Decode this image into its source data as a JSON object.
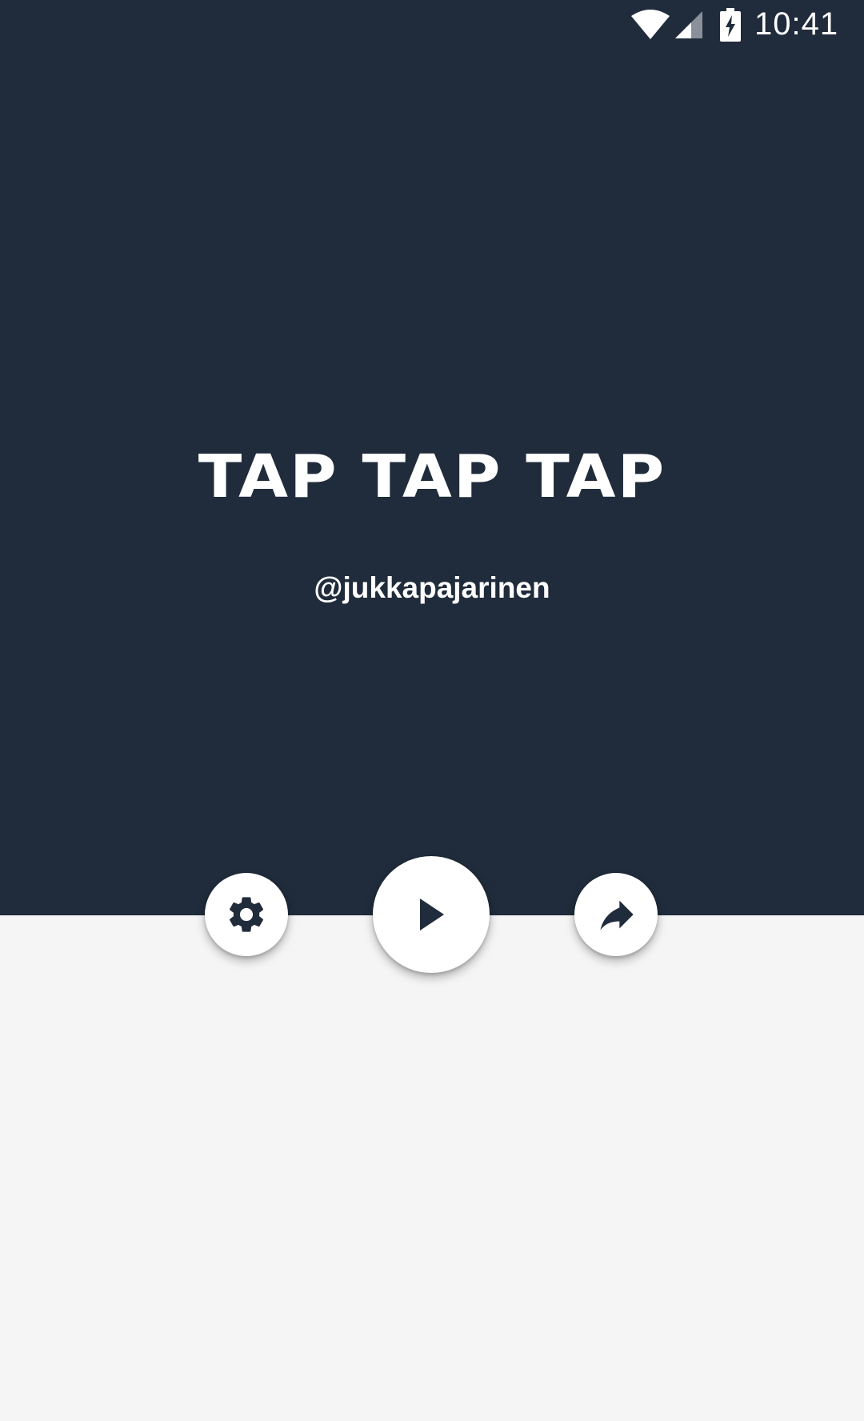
{
  "status_bar": {
    "time": "10:41",
    "icons": [
      "wifi-icon",
      "cell-signal-icon",
      "battery-charging-icon"
    ]
  },
  "title": "TAP TAP TAP",
  "author": "@jukkapajarinen",
  "buttons": {
    "settings": {
      "icon": "gear-icon"
    },
    "play": {
      "icon": "play-icon"
    },
    "share": {
      "icon": "share-arrow-icon"
    }
  },
  "colors": {
    "top_background": "#202c3b",
    "bottom_background": "#f5f5f5",
    "button_background": "#ffffff",
    "icon_color": "#202c3b",
    "text_color": "#ffffff"
  }
}
